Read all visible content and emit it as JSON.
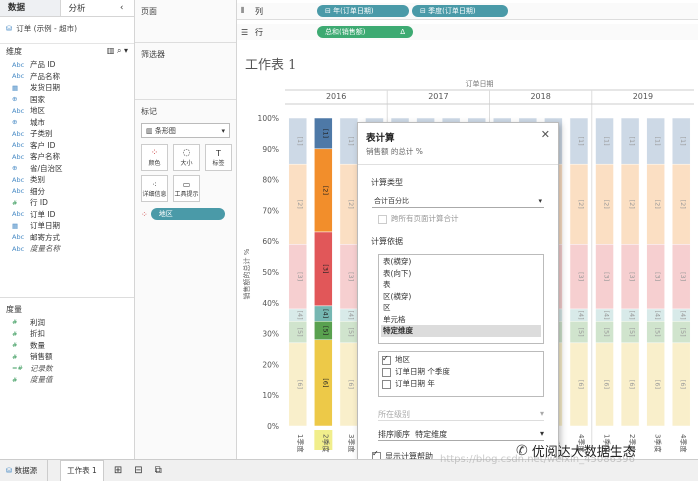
{
  "leftpane": {
    "tab_data": "数据",
    "tab_analysis": "分析",
    "datasource": "订单 (示例 - 超市)",
    "dimensions_title": "维度",
    "dimensions": [
      {
        "type": "Abc",
        "label": "产品 ID"
      },
      {
        "type": "Abc",
        "label": "产品名称"
      },
      {
        "type": "cal",
        "label": "发货日期"
      },
      {
        "type": "globe",
        "label": "国家"
      },
      {
        "type": "Abc",
        "label": "地区"
      },
      {
        "type": "globe",
        "label": "城市"
      },
      {
        "type": "Abc",
        "label": "子类别"
      },
      {
        "type": "Abc",
        "label": "客户 ID"
      },
      {
        "type": "Abc",
        "label": "客户名称"
      },
      {
        "type": "globe",
        "label": "省/自治区"
      },
      {
        "type": "Abc",
        "label": "类别"
      },
      {
        "type": "Abc",
        "label": "细分"
      },
      {
        "type": "#",
        "label": "行 ID"
      },
      {
        "type": "Abc",
        "label": "订单 ID"
      },
      {
        "type": "cal",
        "label": "订单日期"
      },
      {
        "type": "Abc",
        "label": "邮寄方式"
      },
      {
        "type": "Abc",
        "label": "度量名称",
        "italic": true
      }
    ],
    "measures_title": "度量",
    "measures": [
      {
        "type": "#",
        "label": "利润"
      },
      {
        "type": "#",
        "label": "折扣"
      },
      {
        "type": "#",
        "label": "数量"
      },
      {
        "type": "#",
        "label": "销售额"
      },
      {
        "type": "=#",
        "label": "记录数",
        "italic": true
      },
      {
        "type": "#",
        "label": "度量值",
        "italic": true
      }
    ]
  },
  "midpane": {
    "pages": "页面",
    "filters": "筛选器",
    "marks": "标记",
    "mark_type": "条形图",
    "mark_buttons": [
      "颜色",
      "大小",
      "标签",
      "详细信息",
      "工具提示"
    ],
    "color_pill": "地区"
  },
  "shelves": {
    "columns_label": "列",
    "rows_label": "行",
    "col_pill_1": "年(订单日期)",
    "col_pill_2": "季度(订单日期)",
    "row_pill": "总和(销售额)"
  },
  "chart": {
    "sheet_title": "工作表 1",
    "x_header": "订单日期",
    "y_axis_label": "销售额的总计 %",
    "years": [
      "2016",
      "2017",
      "2018",
      "2019"
    ],
    "y_ticks": [
      "100%",
      "90%",
      "80%",
      "70%",
      "60%",
      "50%",
      "40%",
      "30%",
      "20%",
      "10%",
      "0%"
    ],
    "bottom_labels": [
      "1季度",
      "2季度",
      "3季度",
      "4季度"
    ]
  },
  "chart_data": {
    "type": "bar",
    "categories": [
      "2016 Q1",
      "2016 Q2",
      "2016 Q3",
      "2016 Q4",
      "2017 Q1",
      "2017 Q2",
      "2017 Q3",
      "2017 Q4",
      "2018 Q1",
      "2018 Q2",
      "2018 Q3",
      "2018 Q4",
      "2019 Q1",
      "2019 Q2",
      "2019 Q3",
      "2019 Q4"
    ],
    "stacked_percent": true,
    "segment_labels": [
      "[1]",
      "[2]",
      "[3]",
      "[4]",
      "[5]",
      "[6]"
    ],
    "segments_2016Q2": [
      10,
      27,
      24,
      5,
      6,
      28
    ],
    "segments_typical": [
      15,
      26,
      21,
      4,
      7,
      27
    ],
    "colors": [
      "#4e79a7",
      "#f28e2b",
      "#e15759",
      "#76b7b2",
      "#59a14f",
      "#edc948"
    ],
    "ylim": [
      0,
      100
    ]
  },
  "dialog": {
    "title": "表计算",
    "subtitle": "销售额 的总计 %",
    "calc_type_label": "计算类型",
    "calc_type_value": "合计百分比",
    "across_pages": "跨所有页面计算合计",
    "compute_using_label": "计算依据",
    "compute_options": [
      "表(横穿)",
      "表(向下)",
      "表",
      "区(横穿)",
      "区",
      "单元格",
      "特定维度"
    ],
    "selected_option": "特定维度",
    "dims": [
      {
        "label": "地区",
        "checked": true
      },
      {
        "label": "订单日期 个季度",
        "checked": false
      },
      {
        "label": "订单日期 年",
        "checked": false
      }
    ],
    "level_label": "所在级别",
    "sort_label": "排序顺序",
    "sort_value": "特定维度",
    "show_help": "显示计算帮助"
  },
  "bottombar": {
    "datasource_tab": "数据源",
    "sheet_tab": "工作表 1"
  },
  "watermark": {
    "url": "https://blog.csdn.net/weixin_45086396",
    "brand": "优阅达大数据生态"
  }
}
